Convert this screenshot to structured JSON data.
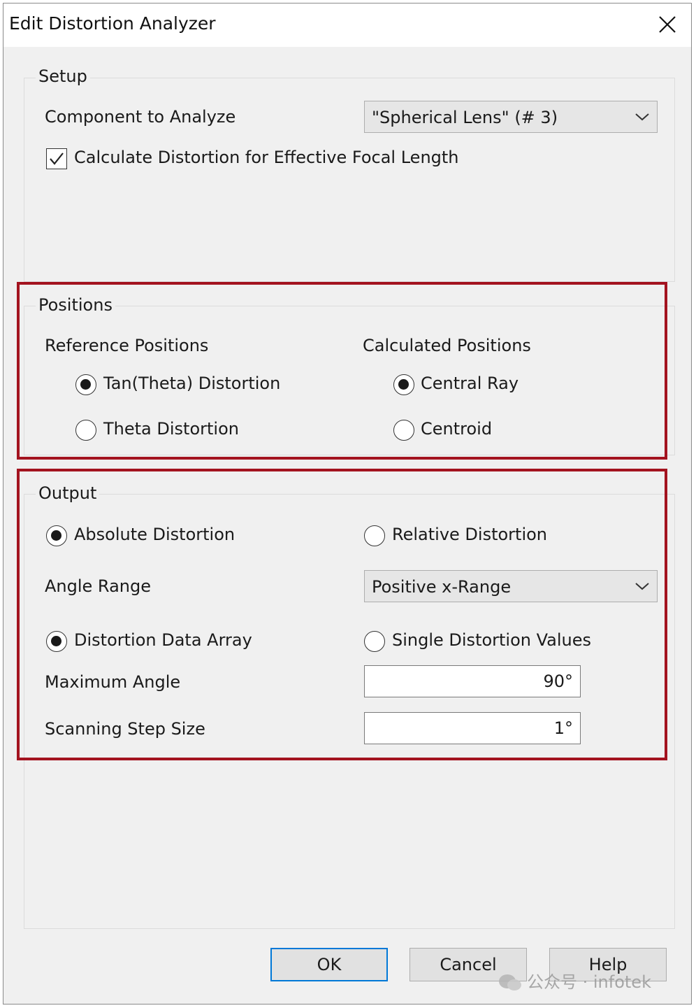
{
  "window": {
    "title": "Edit Distortion Analyzer"
  },
  "setup": {
    "label": "Setup",
    "component_label": "Component to Analyze",
    "component_value": "\"Spherical Lens\" (# 3)",
    "efl_checkbox_label": "Calculate Distortion for Effective Focal Length",
    "efl_checked": true
  },
  "positions": {
    "label": "Positions",
    "reference": {
      "label": "Reference Positions",
      "options": [
        "Tan(Theta) Distortion",
        "Theta Distortion"
      ],
      "selected": 0
    },
    "calculated": {
      "label": "Calculated Positions",
      "options": [
        "Central Ray",
        "Centroid"
      ],
      "selected": 0
    }
  },
  "output": {
    "label": "Output",
    "distortion_type": {
      "options": [
        "Absolute Distortion",
        "Relative Distortion"
      ],
      "selected": 0
    },
    "angle_range_label": "Angle Range",
    "angle_range_value": "Positive x-Range",
    "data_mode": {
      "options": [
        "Distortion Data Array",
        "Single Distortion Values"
      ],
      "selected": 0
    },
    "max_angle_label": "Maximum Angle",
    "max_angle_value": "90°",
    "step_size_label": "Scanning Step Size",
    "step_size_value": "1°"
  },
  "buttons": {
    "ok": "OK",
    "cancel": "Cancel",
    "help": "Help"
  },
  "watermark": "公众号 · infotek",
  "highlight_color": "#a3131f",
  "accent_color": "#0078d7"
}
